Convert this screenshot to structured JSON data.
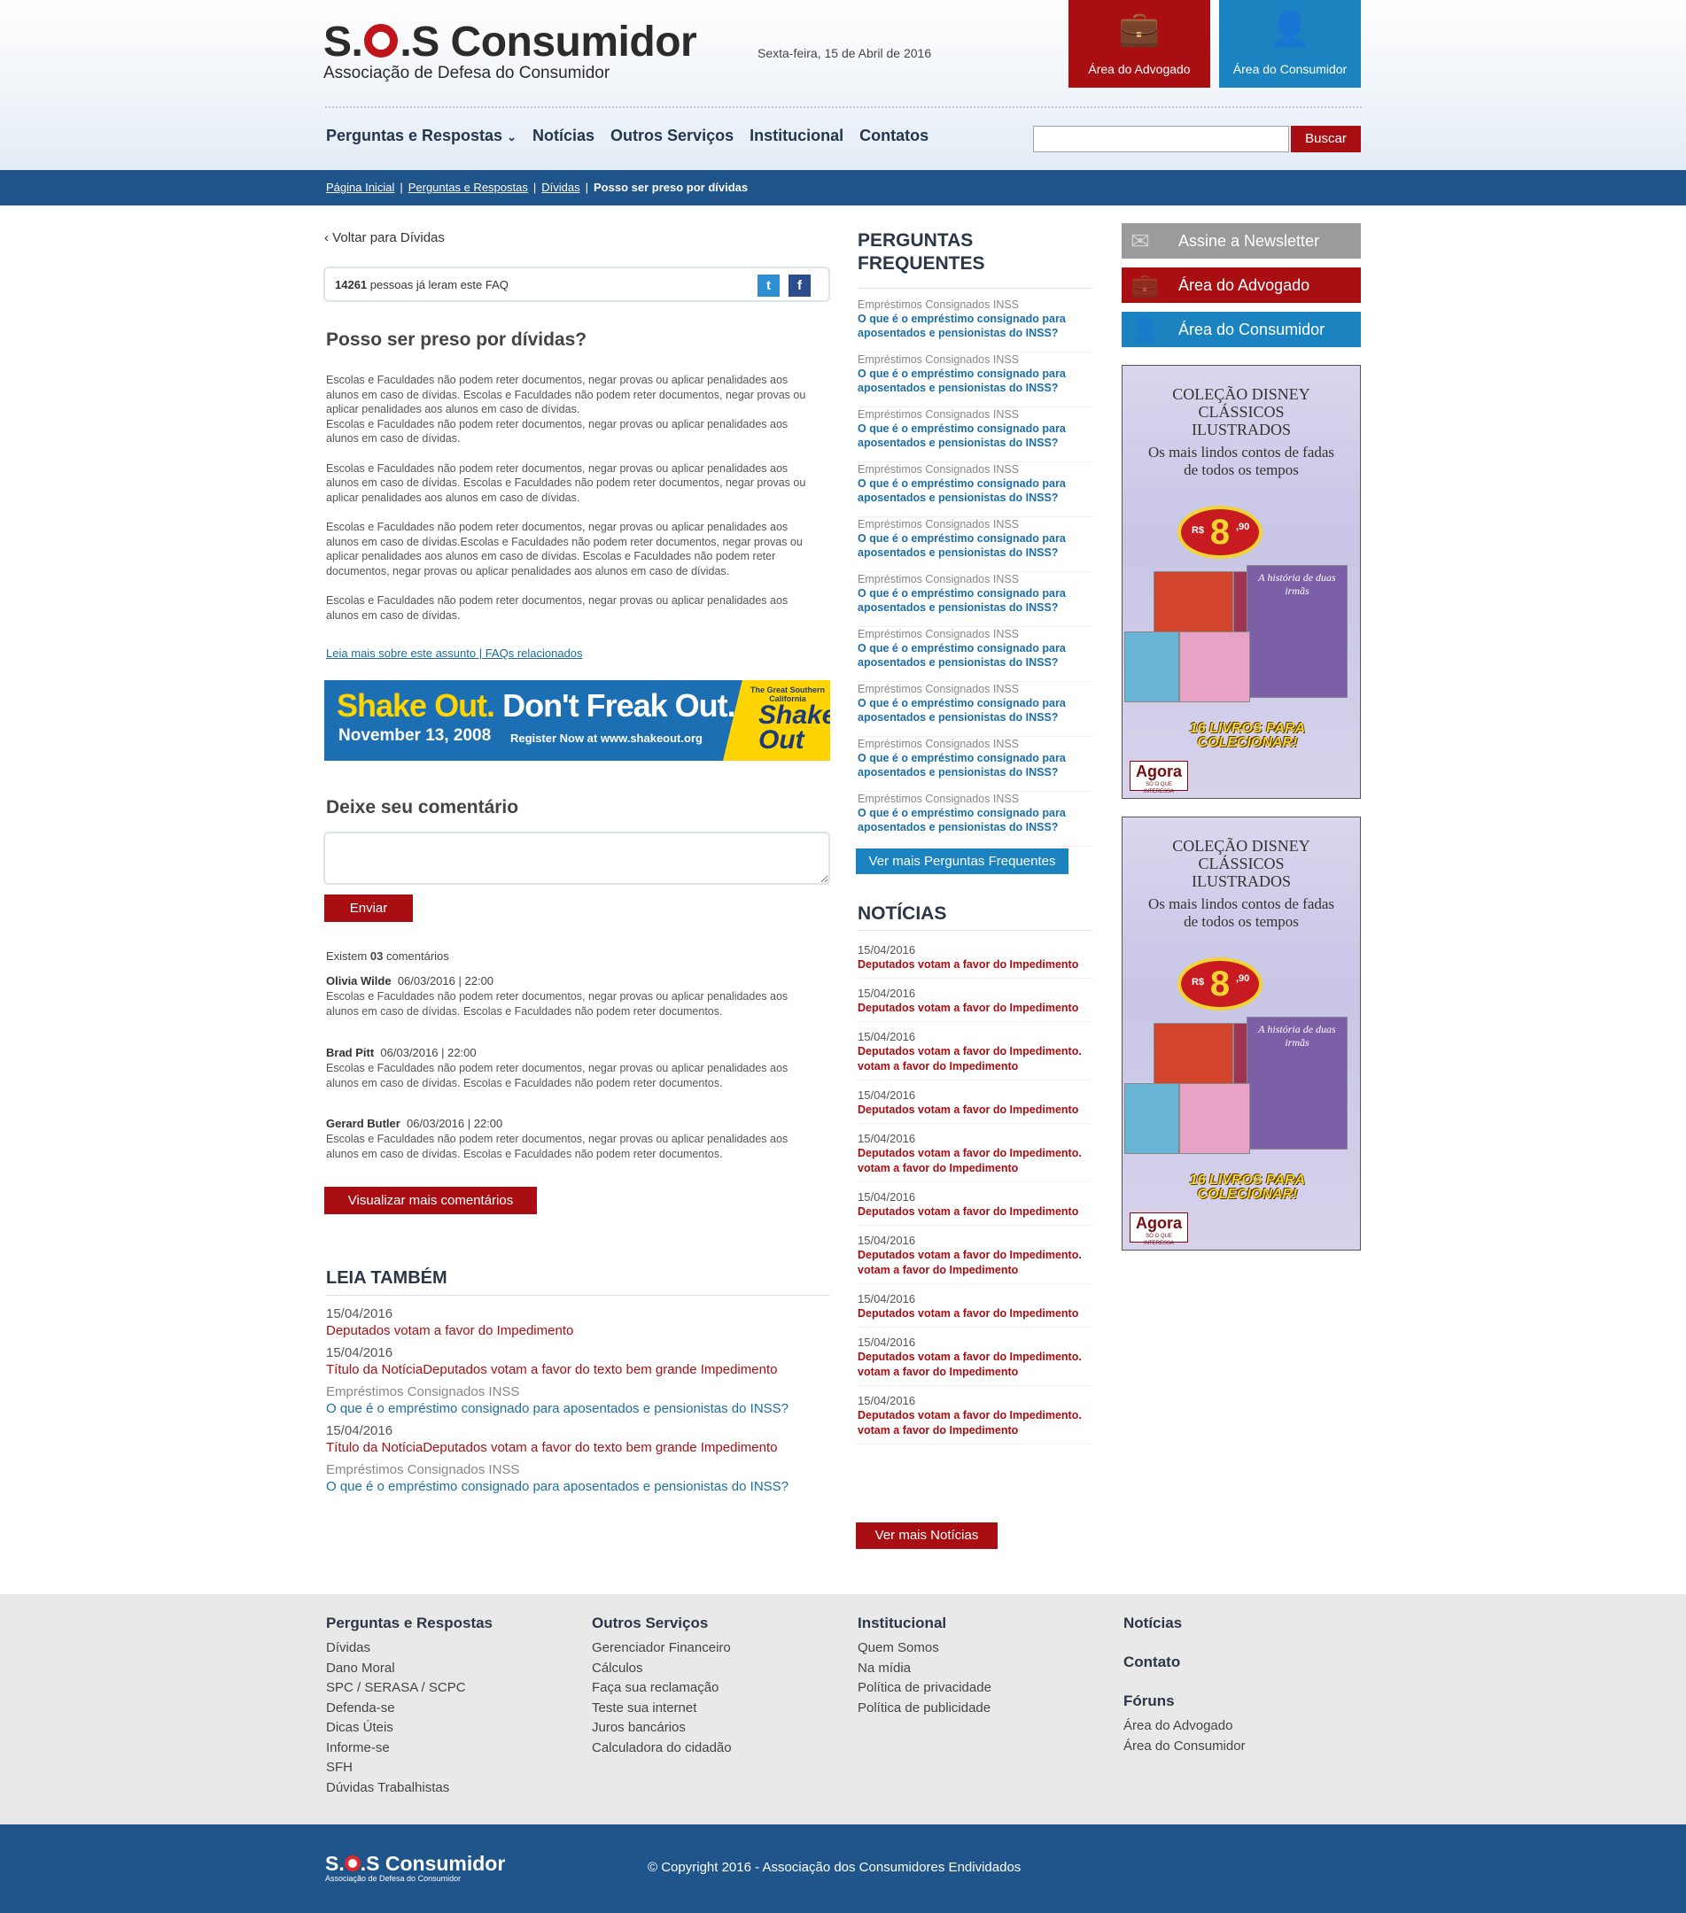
{
  "header": {
    "logo_title_a": "S.",
    "logo_title_b": ".S Consumidor",
    "logo_subtitle": "Associação de Defesa do Consumidor",
    "date": "Sexta-feira, 15 de Abril de 2016",
    "btn_advogado": "Área do Advogado",
    "btn_consumidor": "Área do Consumidor",
    "nav": [
      "Perguntas e Respostas",
      "Notícias",
      "Outros Serviços",
      "Institucional",
      "Contatos"
    ],
    "search_label": "Buscar",
    "search_value": ""
  },
  "breadcrumb": {
    "items": [
      "Página Inicial",
      "Perguntas e Respostas",
      "Dívidas"
    ],
    "current": "Posso ser preso por dívidas"
  },
  "article": {
    "back_label": "Voltar para Dívidas",
    "read_count": "14261",
    "read_text": "pessoas já leram este FAQ",
    "title": "Posso ser preso por dívidas?",
    "paragraphs": [
      "Escolas e Faculdades não podem reter documentos, negar provas ou aplicar penalidades aos alunos em caso de dívidas. Escolas e Faculdades não podem reter documentos, negar provas ou aplicar penalidades aos alunos em caso de dívidas.\nEscolas e Faculdades não podem reter documentos, negar provas ou aplicar penalidades aos alunos em caso de dívidas.",
      "Escolas e Faculdades não podem reter documentos, negar provas ou aplicar penalidades aos alunos em caso de dívidas. Escolas e Faculdades não podem reter documentos, negar provas ou aplicar penalidades aos alunos em caso de dívidas.",
      "Escolas e Faculdades não podem reter documentos, negar provas ou aplicar penalidades aos alunos em caso de dívidas.Escolas e Faculdades não podem reter documentos, negar provas ou aplicar penalidades aos alunos em caso de dívidas. Escolas e Faculdades não podem reter documentos, negar provas ou aplicar penalidades aos alunos em caso de dívidas.",
      "Escolas e Faculdades não podem reter documentos, negar provas ou aplicar penalidades aos alunos em caso de dívidas."
    ],
    "read_more": "Leia mais sobre este assunto | FAQs relacionados"
  },
  "banner": {
    "line1_a": "Shake Out.",
    "line1_b": "Don't Freak Out.",
    "date": "November 13, 2008",
    "register": "Register Now at www.shakeout.org",
    "badge_top": "The Great Southern California",
    "badge_logo": "Shake Out"
  },
  "comments": {
    "title": "Deixe seu comentário",
    "input_value": "",
    "send_label": "Enviar",
    "count_prefix": "Existem",
    "count": "03",
    "count_suffix": "comentários",
    "items": [
      {
        "author": "Olivia Wilde",
        "date": "06/03/2016",
        "time": "22:00",
        "text": "Escolas e Faculdades não podem reter documentos, negar provas ou aplicar penalidades aos alunos em caso de dívidas. Escolas e Faculdades não podem reter documentos."
      },
      {
        "author": "Brad Pitt",
        "date": "06/03/2016",
        "time": "22:00",
        "text": "Escolas e Faculdades não podem reter documentos, negar provas ou aplicar penalidades aos alunos em caso de dívidas. Escolas e Faculdades não podem reter documentos."
      },
      {
        "author": "Gerard Butler",
        "date": "06/03/2016",
        "time": "22:00",
        "text": "Escolas e Faculdades não podem reter documentos, negar provas ou aplicar penalidades aos alunos em caso de dívidas. Escolas e Faculdades não podem reter documentos."
      }
    ],
    "more_label": "Visualizar mais comentários"
  },
  "leia": {
    "title": "LEIA TAMBÉM",
    "items": [
      {
        "meta": "15/04/2016",
        "title": "Deputados votam a favor do Impedimento",
        "kind": "news"
      },
      {
        "meta": "15/04/2016",
        "title": "Título da NotíciaDeputados votam a favor do texto bem grande Impedimento",
        "kind": "news"
      },
      {
        "meta": "Empréstimos Consignados INSS",
        "title": "O que é o empréstimo consignado para aposentados e pensionistas do INSS?",
        "kind": "faq"
      },
      {
        "meta": "15/04/2016",
        "title": "Título da NotíciaDeputados votam a favor do texto bem grande Impedimento",
        "kind": "news"
      },
      {
        "meta": "Empréstimos Consignados INSS",
        "title": "O que é o empréstimo consignado para aposentados e pensionistas do INSS?",
        "kind": "faq"
      }
    ]
  },
  "faq": {
    "title_1": "PERGUNTAS",
    "title_2": "FREQUENTES",
    "category": "Empréstimos Consignados INSS",
    "question": "O que é o empréstimo consignado para aposentados e pensionistas do INSS?",
    "count": 10,
    "more_label": "Ver mais Perguntas Frequentes"
  },
  "news": {
    "title": "NOTÍCIAS",
    "items": [
      {
        "date": "15/04/2016",
        "title": "Deputados votam a favor do Impedimento"
      },
      {
        "date": "15/04/2016",
        "title": "Deputados votam a favor do Impedimento"
      },
      {
        "date": "15/04/2016",
        "title": "Deputados votam a favor do Impedimento. votam a favor do Impedimento"
      },
      {
        "date": "15/04/2016",
        "title": "Deputados votam a favor do Impedimento"
      },
      {
        "date": "15/04/2016",
        "title": "Deputados votam a favor do Impedimento. votam a favor do Impedimento"
      },
      {
        "date": "15/04/2016",
        "title": "Deputados votam a favor do Impedimento"
      },
      {
        "date": "15/04/2016",
        "title": "Deputados votam a favor do Impedimento. votam a favor do Impedimento"
      },
      {
        "date": "15/04/2016",
        "title": "Deputados votam a favor do Impedimento"
      },
      {
        "date": "15/04/2016",
        "title": "Deputados votam a favor do Impedimento. votam a favor do Impedimento"
      },
      {
        "date": "15/04/2016",
        "title": "Deputados votam a favor do Impedimento. votam a favor do Impedimento"
      }
    ],
    "more_label": "Ver mais Notícias"
  },
  "sidebar": {
    "newsletter": "Assine a Newsletter",
    "advogado": "Área do Advogado",
    "consumidor": "Área do Consumidor"
  },
  "ad": {
    "title": "COLEÇÃO DISNEY CLÁSSICOS ILUSTRADOS",
    "subtitle": "Os mais lindos contos de fadas de todos os tempos",
    "price_currency": "R$",
    "price_big": "8",
    "price_cents": ",90",
    "book_title": "A história de duas irmãs",
    "collect": "16 LIVROS PARA COLECIONAR!",
    "brand": "Agora",
    "brand_tag": "SÓ O QUE INTERESSA"
  },
  "footer": {
    "col1": {
      "title": "Perguntas e Respostas",
      "links": [
        "Dívidas",
        "Dano Moral",
        "SPC / SERASA / SCPC",
        "Defenda-se",
        "Dicas Úteis",
        "Informe-se",
        "SFH",
        "Dúvidas Trabalhistas"
      ]
    },
    "col2": {
      "title": "Outros Serviços",
      "links": [
        "Gerenciador Financeiro",
        "Cálculos",
        "Faça sua reclamação",
        "Teste sua internet",
        "Juros bancários",
        "Calculadora do cidadão"
      ]
    },
    "col3": {
      "title": "Institucional",
      "links": [
        "Quem Somos",
        "Na mídia",
        "Política de privacidade",
        "Política de publicidade"
      ]
    },
    "col4": {
      "title_noticias": "Notícias",
      "title_contato": "Contato",
      "title_foruns": "Fóruns",
      "links": [
        "Área do Advogado",
        "Área do Consumidor"
      ]
    },
    "copyright": "© Copyright 2016 - Associação dos Consumidores Endividados"
  }
}
